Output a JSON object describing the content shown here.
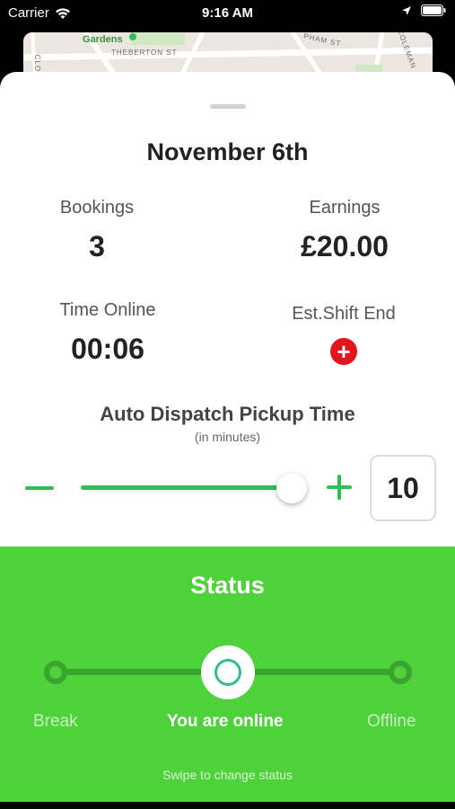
{
  "status_bar": {
    "carrier": "Carrier",
    "time": "9:16 AM"
  },
  "map": {
    "streets": [
      "Gardens",
      "THEBERTON ST",
      "PHAM ST",
      "COLEMAN",
      "CLO"
    ]
  },
  "summary": {
    "date": "November 6th",
    "bookings_label": "Bookings",
    "bookings_value": "3",
    "earnings_label": "Earnings",
    "earnings_value": "£20.00",
    "time_online_label": "Time Online",
    "time_online_value": "00:06",
    "shift_end_label": "Est.Shift End"
  },
  "dispatch": {
    "title": "Auto Dispatch Pickup Time",
    "subtitle": "(in minutes)",
    "value": "10"
  },
  "status": {
    "title": "Status",
    "options": [
      "Break",
      "You are online",
      "Offline"
    ],
    "hint": "Swipe to change status"
  },
  "colors": {
    "accent_green": "#2dbe57",
    "panel_green": "#4fd13c",
    "add_red": "#e3141c"
  }
}
